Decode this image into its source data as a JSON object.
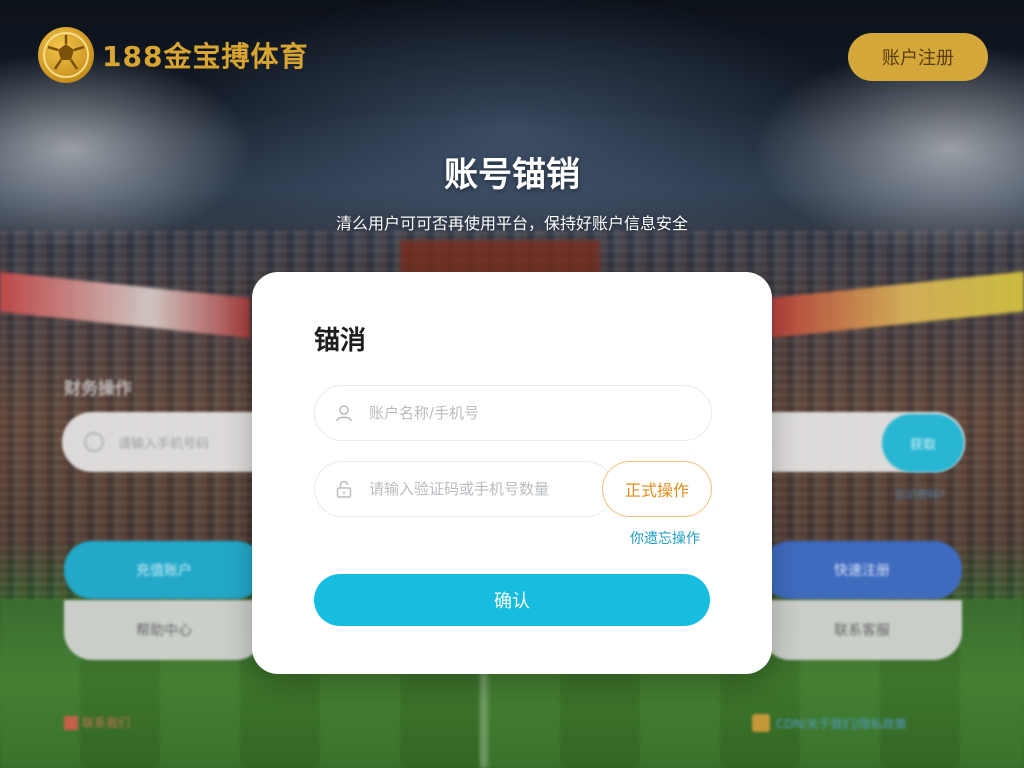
{
  "header": {
    "logo_text": "188金宝搏体育",
    "logo_icon": "soccer-ball-icon",
    "action_button_label": "账户注册"
  },
  "hero": {
    "title": "账号锚销",
    "subtitle": "清么用户可可否再使用平台，保持好账户信息安全"
  },
  "form": {
    "heading": "锚消",
    "username": {
      "placeholder": "账户名称/手机号",
      "value": "",
      "icon": "user-icon"
    },
    "code": {
      "placeholder": "请输入验证码或手机号数量",
      "value": "",
      "icon": "lock-icon"
    },
    "code_button_label": "正式操作",
    "forgot_link_label": "你遗忘操作",
    "submit_label": "确认"
  },
  "background": {
    "left_section_label": "财务操作",
    "left_input_placeholder": "请输入手机号码",
    "right_button_label": "获取",
    "right_link_label": "忘记密码?",
    "left_teal_button": "充值账户",
    "left_grey_button": "帮助中心",
    "right_blue_button": "快速注册",
    "right_grey_button": "联系客服",
    "footer_left": "联系我们",
    "footer_right": "CDN/关于我们/隐私政策"
  },
  "colors": {
    "accent_cyan": "#17bde0",
    "gold": "#d3a73a",
    "orange": "#e08d1b",
    "link_blue": "#1f9ec3"
  }
}
